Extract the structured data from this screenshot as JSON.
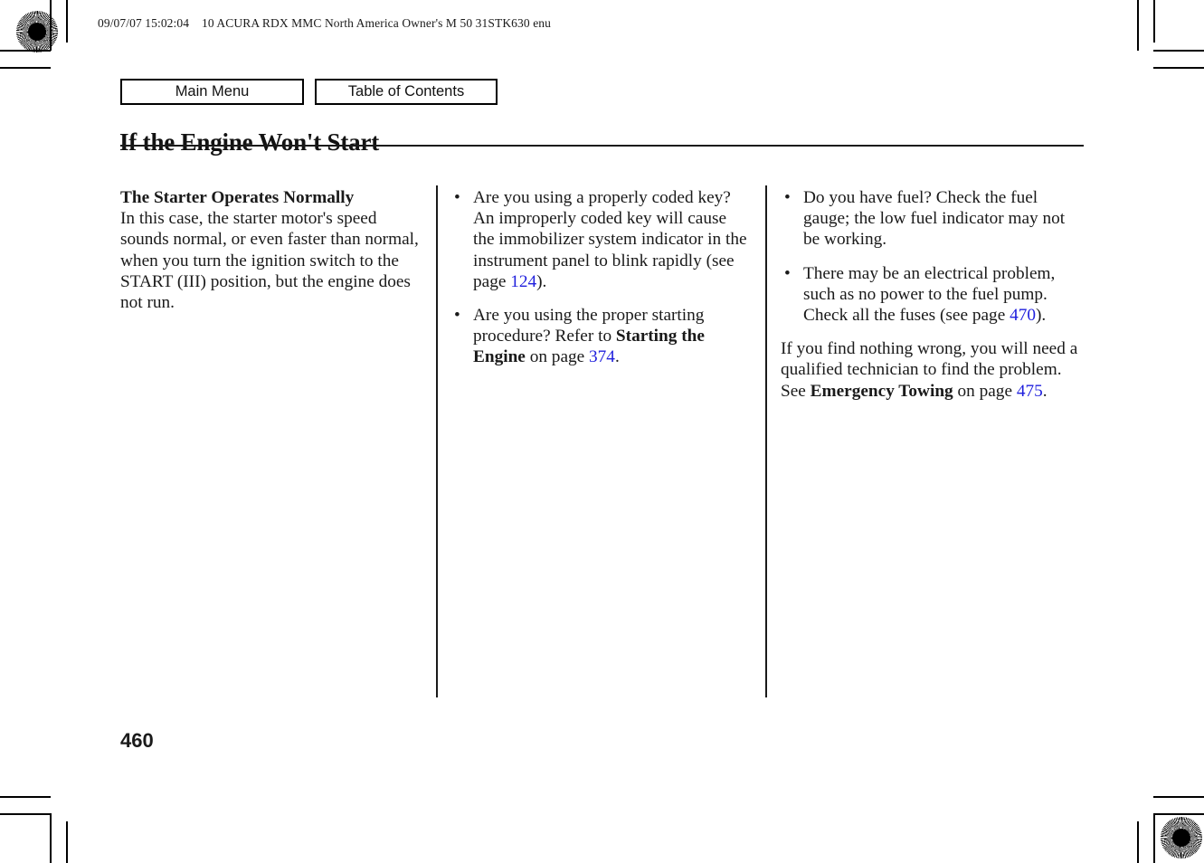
{
  "document": {
    "header_line": "09/07/07 15:02:04    10 ACURA RDX MMC North America Owner's M 50 31STK630 enu",
    "title": "If the Engine Won't Start",
    "folio": "460",
    "link_color": "#2020dd"
  },
  "nav": {
    "main_menu_label": "Main Menu",
    "table_of_contents_label": "Table of Contents"
  },
  "columns": {
    "col1": {
      "subhead": "The Starter Operates Normally",
      "paragraph": "In this case, the starter motor's speed sounds normal, or even faster than normal, when you turn the ignition switch to the START (III) position, but the engine does not run."
    },
    "col2": {
      "bullet_marker": "•",
      "bullet1_part1": "Are you using a properly coded key? An improperly coded key will cause the immobilizer system indicator in the instrument panel to blink rapidly (see page ",
      "bullet1_link": "124",
      "bullet1_part2": ").",
      "bullet2_part1": "Are you using the proper starting procedure? Refer to ",
      "bullet2_bold": "Starting the Engine",
      "bullet2_part2": " on page ",
      "bullet2_link": "374",
      "bullet2_part3": "."
    },
    "col3": {
      "bullet_marker": "•",
      "bullet1": "Do you have fuel? Check the fuel gauge; the low fuel indicator may not be working.",
      "bullet2_part1": "There may be an electrical problem, such as no power to the fuel pump. Check all the fuses (see page ",
      "bullet2_link": "470",
      "bullet2_part2": ").",
      "closing_part1": "If you find nothing wrong, you will need a qualified technician to find the problem. See ",
      "closing_bold": "Emergency Towing",
      "closing_part2": " on page ",
      "closing_link": "475",
      "closing_part3": "."
    }
  }
}
